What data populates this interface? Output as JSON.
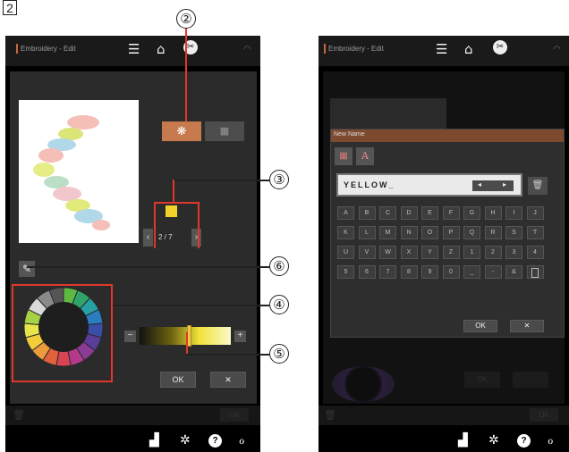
{
  "figure_label": "2",
  "callouts": [
    "②",
    "③",
    "④",
    "⑤",
    "⑥"
  ],
  "left_screen": {
    "title": "Embroidery - Edit",
    "counter": "2 / 7",
    "ok_label": "OK",
    "cancel_label": "✕",
    "bottom_ok_label": "OK",
    "minus_label": "−",
    "plus_label": "+",
    "selected_color": "#f2d22a",
    "brightness_level": 0.54
  },
  "right_screen": {
    "title": "Embroidery - Edit",
    "dialog_title": "New Name",
    "name_value": "YELLOW_",
    "keys": [
      "A",
      "B",
      "C",
      "D",
      "E",
      "F",
      "G",
      "H",
      "I",
      "J",
      "K",
      "L",
      "M",
      "N",
      "O",
      "P",
      "Q",
      "R",
      "S",
      "T",
      "U",
      "V",
      "W",
      "X",
      "Y",
      "Z",
      "1",
      "2",
      "3",
      "4",
      "5",
      "6",
      "7",
      "8",
      "9",
      "0",
      "_",
      "-",
      "&"
    ],
    "ok_label": "OK",
    "cancel_label": "✕",
    "bg_ok_label": "OK",
    "bottom_ok_label": "OK"
  },
  "icons": [
    "menu-icon",
    "home-icon",
    "embroidery-mode-icon",
    "wifi-icon",
    "pencil-icon",
    "trash-icon",
    "thread-spool-icon",
    "gear-icon",
    "help-icon",
    "wrench-icon"
  ],
  "colors": {
    "accent": "#c87a4f",
    "callout_line": "#e0372c",
    "dialog_bg": "#2b2b2b",
    "header_bar": "#8a4f33"
  }
}
